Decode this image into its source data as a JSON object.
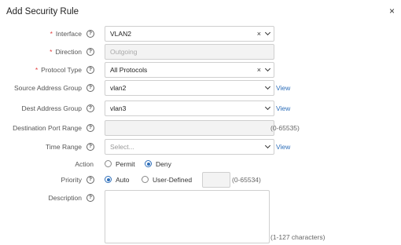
{
  "dialog": {
    "title": "Add Security Rule",
    "close_glyph": "×"
  },
  "help_glyph": "?",
  "interface": {
    "label": "Interface",
    "value": "VLAN2",
    "clear_glyph": "×"
  },
  "direction": {
    "label": "Direction",
    "value": "Outgoing"
  },
  "protocol": {
    "label": "Protocol Type",
    "value": "All Protocols",
    "clear_glyph": "×"
  },
  "source_group": {
    "label": "Source Address Group",
    "value": "vlan2",
    "link": "View"
  },
  "dest_group": {
    "label": "Dest Address Group",
    "value": "vlan3",
    "link": "View"
  },
  "dest_port": {
    "label": "Destination Port Range",
    "value": "",
    "hint": "(0-65535)"
  },
  "time_range": {
    "label": "Time Range",
    "placeholder": "Select...",
    "link": "View"
  },
  "action": {
    "label": "Action",
    "options": [
      "Permit",
      "Deny"
    ],
    "selected": "Deny"
  },
  "priority": {
    "label": "Priority",
    "options": [
      "Auto",
      "User-Defined"
    ],
    "selected": "Auto",
    "hint": "(0-65534)"
  },
  "description": {
    "label": "Description",
    "hint": "(1-127 characters)"
  },
  "required_mark": "*"
}
